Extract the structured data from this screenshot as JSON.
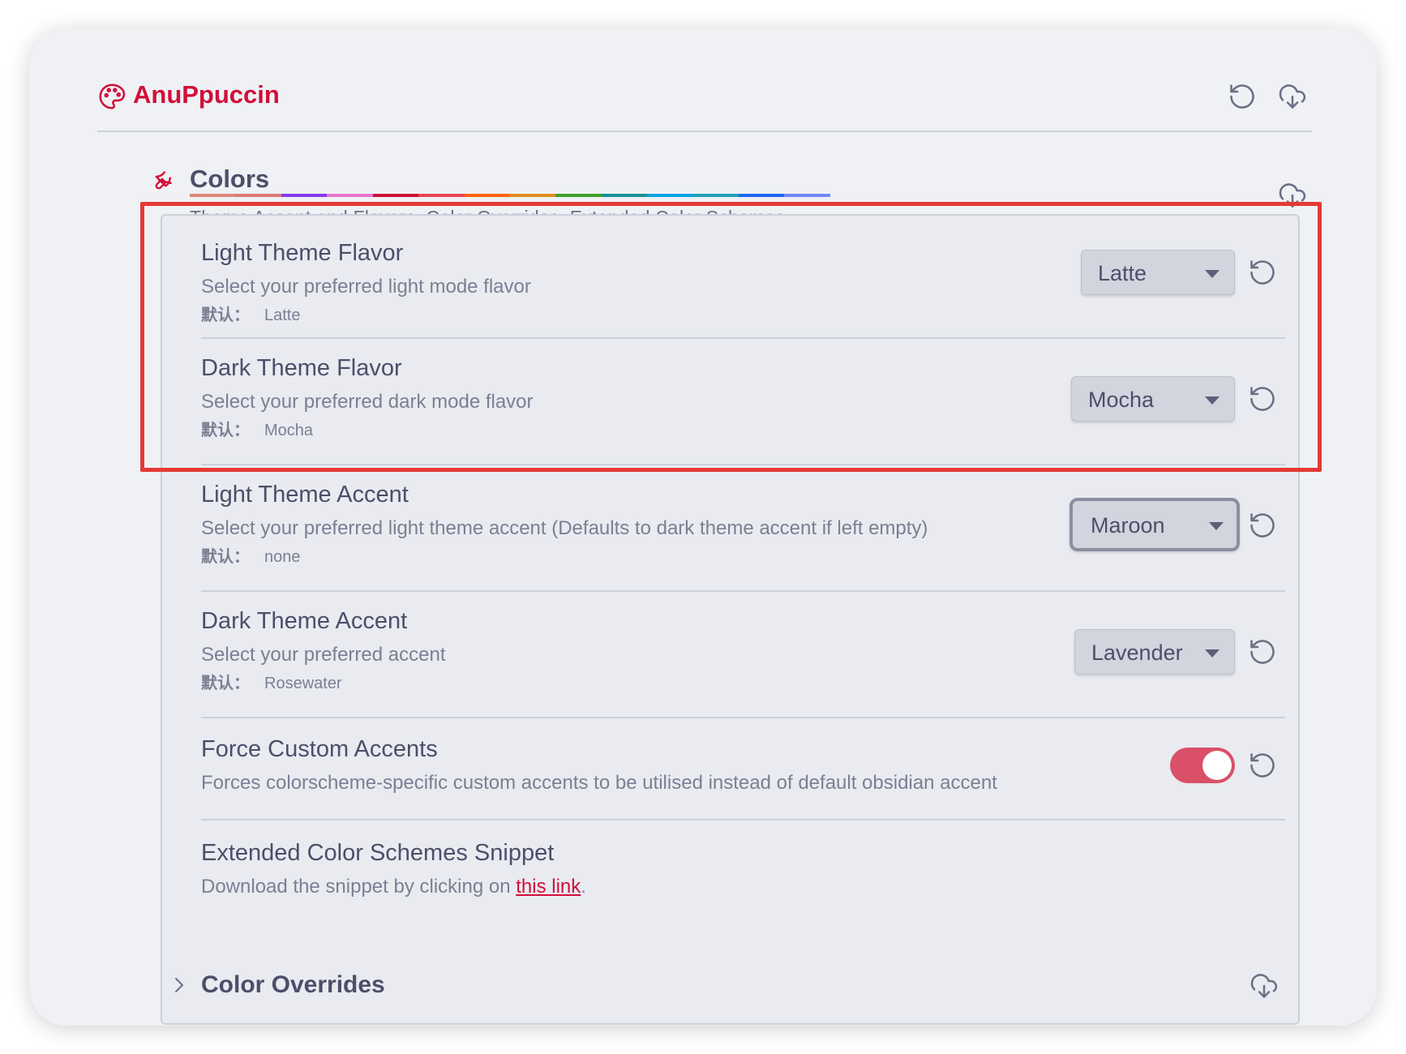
{
  "app": {
    "title": "AnuPpuccin",
    "accent_color": "#d20f39"
  },
  "section": {
    "title": "Colors",
    "description": "Theme Accent and Flavors, Color Overrides, Extended Color Schemes",
    "rainbow_colors": [
      "#dc8a78",
      "#dd7878",
      "#8839ef",
      "#ea76cb",
      "#d20f39",
      "#e64553",
      "#fe640b",
      "#df8e1d",
      "#40a02b",
      "#179299",
      "#04a5e5",
      "#209fb5",
      "#1e66f5",
      "#7287fd"
    ]
  },
  "default_label": "默认：",
  "settings": [
    {
      "name": "Light Theme Flavor",
      "desc": "Select your preferred light mode flavor",
      "default": "Latte",
      "value": "Latte"
    },
    {
      "name": "Dark Theme Flavor",
      "desc": "Select your preferred dark mode flavor",
      "default": "Mocha",
      "value": "Mocha"
    },
    {
      "name": "Light Theme Accent",
      "desc": "Select your preferred light theme accent (Defaults to dark theme accent if left empty)",
      "default": "none",
      "value": "Maroon"
    },
    {
      "name": "Dark Theme Accent",
      "desc": "Select your preferred accent",
      "default": "Rosewater",
      "value": "Lavender"
    },
    {
      "name": "Force Custom Accents",
      "desc": "Forces colorscheme-specific custom accents to be utilised instead of default obsidian accent",
      "enabled": true,
      "toggle_color": "#d95068"
    },
    {
      "name": "Extended Color Schemes Snippet",
      "desc_prefix": "Download the snippet by clicking on ",
      "link_text": "this link",
      "desc_suffix": "."
    }
  ],
  "overrides": {
    "title": "Color Overrides"
  },
  "icons": {
    "logo": "palette-icon",
    "header_reset": "reset-icon",
    "header_download": "cloud-download-icon",
    "section": "paintbrush-icon",
    "collapse": "chevron-right-icon"
  },
  "highlight_color": "#e53935"
}
